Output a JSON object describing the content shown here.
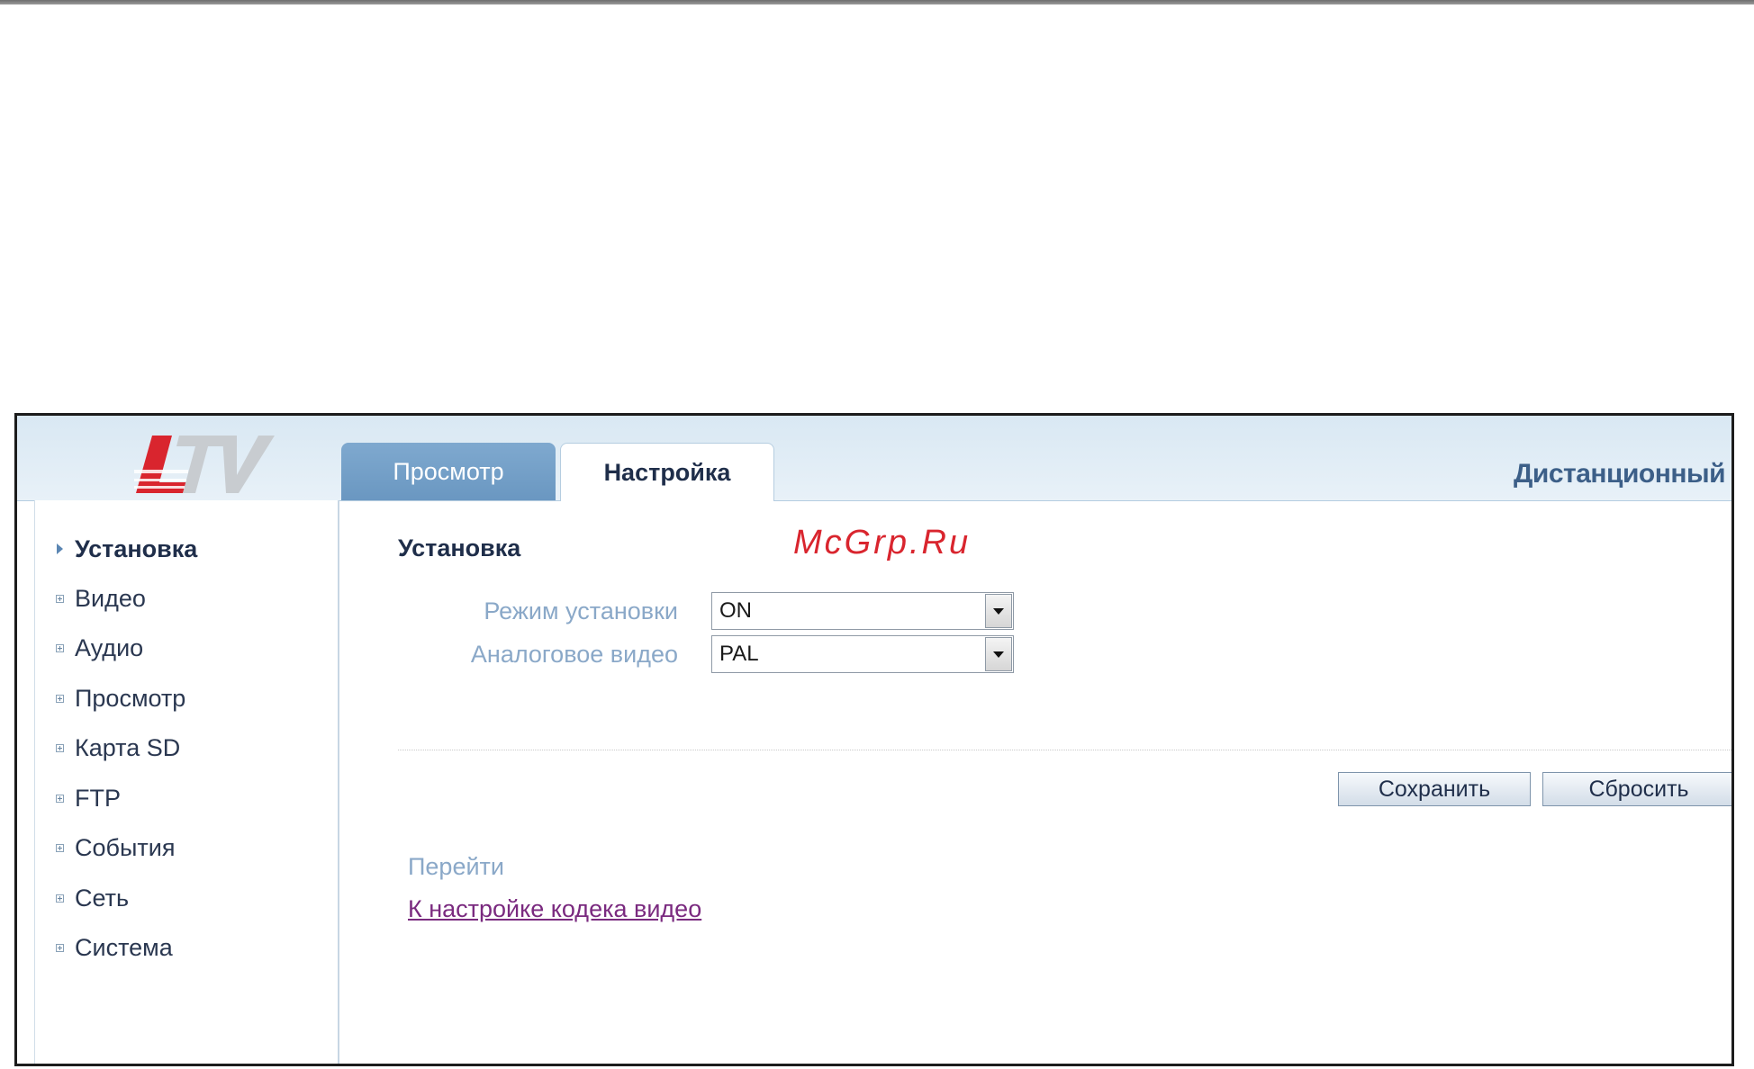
{
  "brand": {
    "logo_text": "LTV",
    "logo_color": "#d9252e"
  },
  "watermark": "McGrp.Ru",
  "header": {
    "tabs": [
      {
        "label": "Просмотр",
        "active": false
      },
      {
        "label": "Настройка",
        "active": true
      }
    ],
    "title": "Дистанционный г"
  },
  "sidebar": {
    "items": [
      {
        "label": "Установка",
        "active": true
      },
      {
        "label": "Видео"
      },
      {
        "label": "Аудио"
      },
      {
        "label": "Просмотр"
      },
      {
        "label": "Карта SD"
      },
      {
        "label": "FTP"
      },
      {
        "label": "События"
      },
      {
        "label": "Сеть"
      },
      {
        "label": "Система"
      }
    ]
  },
  "main": {
    "title": "Установка",
    "fields": [
      {
        "label": "Режим установки",
        "value": "ON"
      },
      {
        "label": "Аналоговое видео",
        "value": "PAL"
      }
    ],
    "buttons": {
      "save": "Сохранить",
      "reset": "Сбросить"
    },
    "goto_label": "Перейти",
    "codec_link": "К настройке кодека видео"
  },
  "colors": {
    "header_bg": "#dde9f4",
    "tab_inactive": "#6f9bc5",
    "label_blue": "#8aa8c8",
    "link_purple": "#7a2a7f",
    "frame_border": "#1c1c1c"
  }
}
